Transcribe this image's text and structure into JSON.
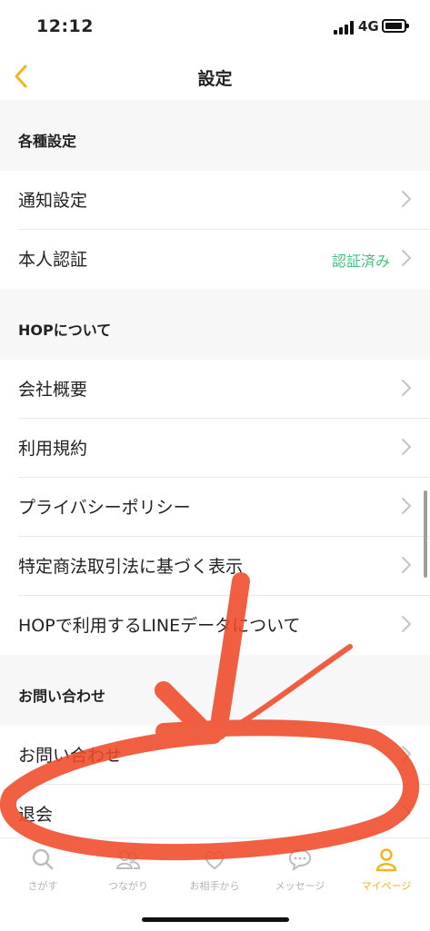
{
  "status_bar": {
    "time": "12:12",
    "network": "4G"
  },
  "nav": {
    "title": "設定"
  },
  "sections": [
    {
      "header": "各種設定",
      "rows": [
        {
          "label": "通知設定"
        },
        {
          "label": "本人認証",
          "status": "認証済み"
        }
      ]
    },
    {
      "header": "HOPについて",
      "rows": [
        {
          "label": "会社概要"
        },
        {
          "label": "利用規約"
        },
        {
          "label": "プライバシーポリシー"
        },
        {
          "label": "特定商法取引法に基づく表示"
        },
        {
          "label": "HOPで利用するLINEデータについて"
        }
      ]
    },
    {
      "header": "お問い合わせ",
      "rows": [
        {
          "label": "お問い合わせ"
        },
        {
          "label": "退会"
        }
      ]
    }
  ],
  "tabs": [
    {
      "label": "さがす",
      "icon": "search-icon"
    },
    {
      "label": "つながり",
      "icon": "people-icon"
    },
    {
      "label": "お相手から",
      "icon": "heart-icon"
    },
    {
      "label": "メッセージ",
      "icon": "chat-icon"
    },
    {
      "label": "マイページ",
      "icon": "person-icon"
    }
  ],
  "colors": {
    "accent": "#f3b51b",
    "verified": "#3ec47a",
    "annotation": "#f04a2a"
  }
}
